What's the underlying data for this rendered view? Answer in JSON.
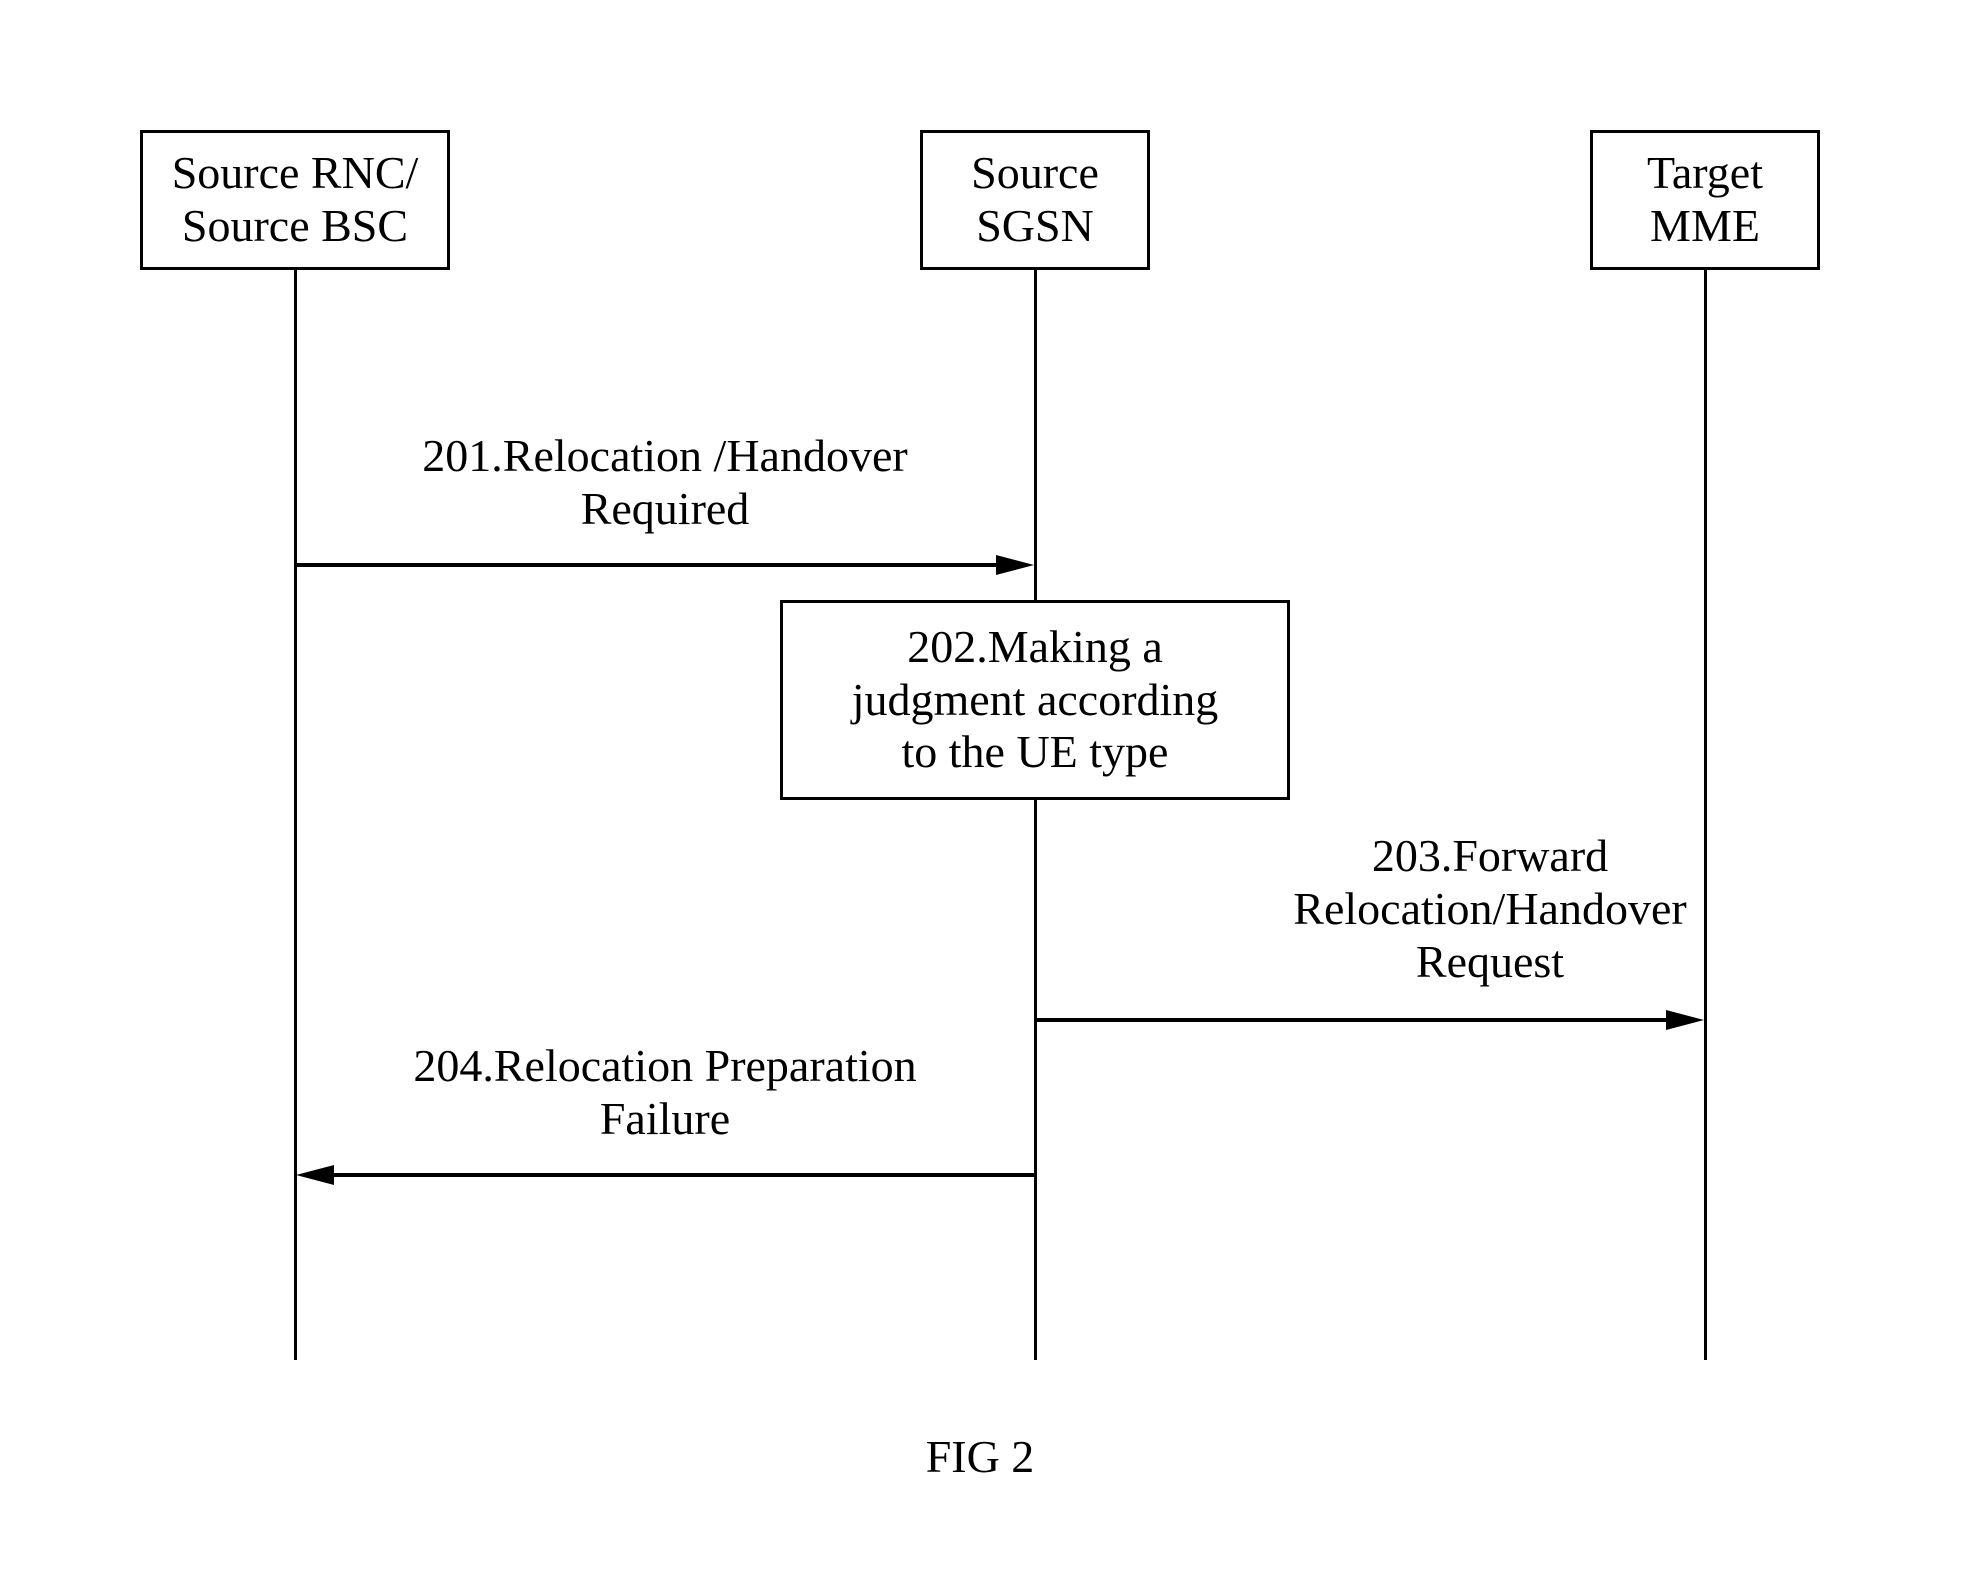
{
  "lifelines": {
    "source_rnc_bsc": "Source RNC/\nSource BSC",
    "source_sgsn": "Source\nSGSN",
    "target_mme": "Target\nMME"
  },
  "messages": {
    "m201": "201.Relocation /Handover\nRequired",
    "m202": "202.Making a\njudgment according\nto the UE type",
    "m203": "203.Forward\nRelocation/Handover\nRequest",
    "m204": "204.Relocation Preparation\nFailure"
  },
  "figure_label": "FIG 2"
}
